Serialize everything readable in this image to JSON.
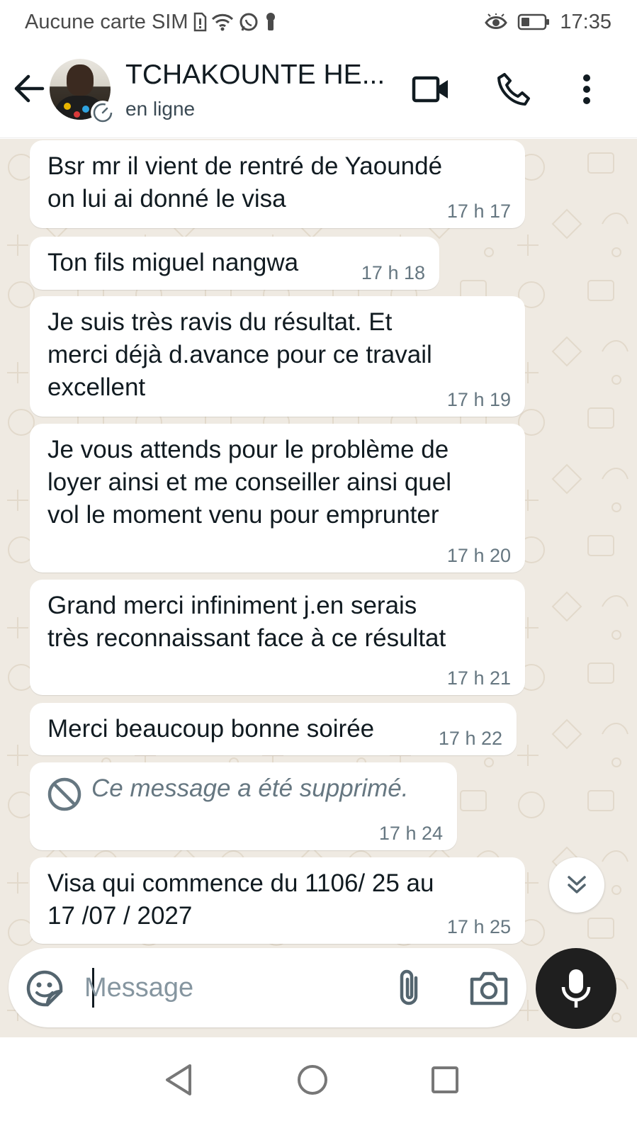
{
  "status_bar": {
    "carrier": "Aucune carte SIM",
    "time": "17:35",
    "icons": [
      "sim-missing-icon",
      "wifi-icon",
      "whatsapp-status-icon",
      "key-icon",
      "eye-icon",
      "battery-icon"
    ]
  },
  "header": {
    "contact_name": "TCHAKOUNTE HE...",
    "presence": "en ligne",
    "icons": [
      "back-arrow-icon",
      "video-call-icon",
      "phone-icon",
      "more-vert-icon"
    ]
  },
  "messages": [
    {
      "text": "Bsr mr il vient de rentré de Yaoundé\non lui ai donné le visa",
      "time": "17 h 17"
    },
    {
      "text": "Ton fils miguel nangwa",
      "time": "17 h 18"
    },
    {
      "text": "Je suis très ravis du résultat. Et\nmerci déjà d.avance pour ce travail\nexcellent",
      "time": "17 h 19"
    },
    {
      "text": "Je vous attends pour le problème de\nloyer ainsi et me conseiller ainsi quel\nvol le moment venu pour emprunter",
      "time": "17 h 20"
    },
    {
      "text": "Grand merci infiniment j.en serais\ntrès reconnaissant face à ce résultat",
      "time": "17 h 21"
    },
    {
      "text": "Merci beaucoup bonne soirée",
      "time": "17 h 22"
    },
    {
      "text": "Ce message a été supprimé.",
      "time": "17 h 24",
      "deleted": true
    },
    {
      "text": "Visa qui commence du 1106/ 25  au\n17 /07 / 2027",
      "time": "17 h 25"
    }
  ],
  "composer": {
    "placeholder": "Message",
    "value": "",
    "icons": [
      "emoji-sticker-icon",
      "attach-icon",
      "camera-icon",
      "mic-icon"
    ]
  },
  "colors": {
    "chat_background": "#efeae2",
    "bubble": "#ffffff",
    "timestamp": "#667781",
    "mic_button": "#1f1f1f"
  },
  "nav": {
    "icons": [
      "nav-back-icon",
      "nav-home-icon",
      "nav-recents-icon"
    ]
  }
}
